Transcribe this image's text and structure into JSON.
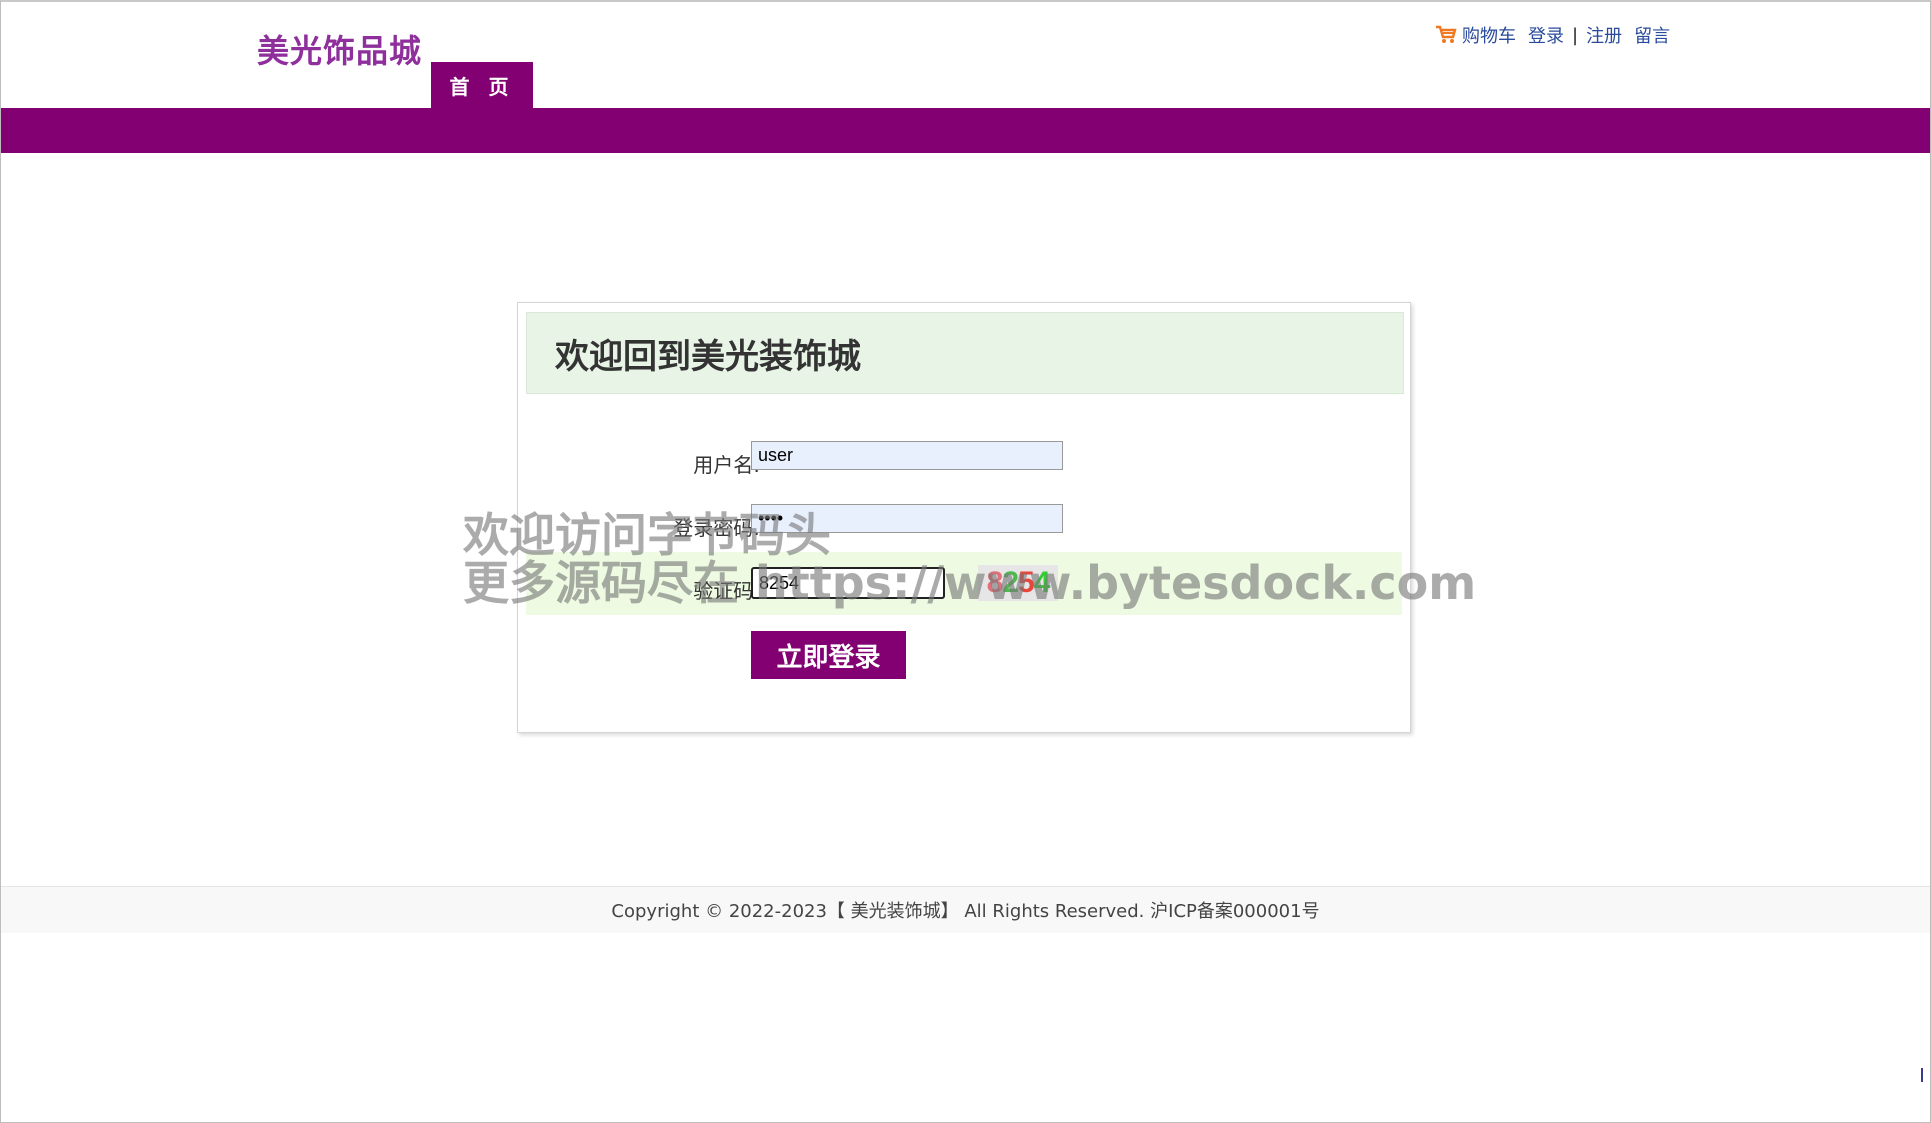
{
  "header": {
    "logo": "美光饰品城",
    "nav_home": "首 页",
    "links": {
      "cart": "购物车",
      "login": "登录",
      "separator": "|",
      "register": "注册",
      "message": "留言"
    }
  },
  "login": {
    "title": "欢迎回到美光装饰城",
    "username_label": "用户名:",
    "username_value": "user",
    "password_label": "登录密码:",
    "password_value": "••••",
    "captcha_label": "验证码:",
    "captcha_value": "8254",
    "captcha_chars": [
      "8",
      "2",
      "5",
      "4"
    ],
    "captcha_colors": [
      "#e0707a",
      "#4fb84f",
      "#e8453c",
      "#33cc33"
    ],
    "submit_label": "立即登录"
  },
  "footer": {
    "copyright": "Copyright © 2022-2023【 美光装饰城】 All Rights Reserved. 沪ICP备案000001号"
  },
  "watermark": {
    "line1": "欢迎访问字节码头",
    "line2": "更多源码尽在  https://www.bytesdock.com"
  },
  "colors": {
    "brand_purple": "#830073",
    "logo": "#8e2f9c",
    "link": "#2a4b9b",
    "header_bg": "#e7f4e6"
  },
  "icons": {
    "cart": "shopping-cart-icon"
  }
}
